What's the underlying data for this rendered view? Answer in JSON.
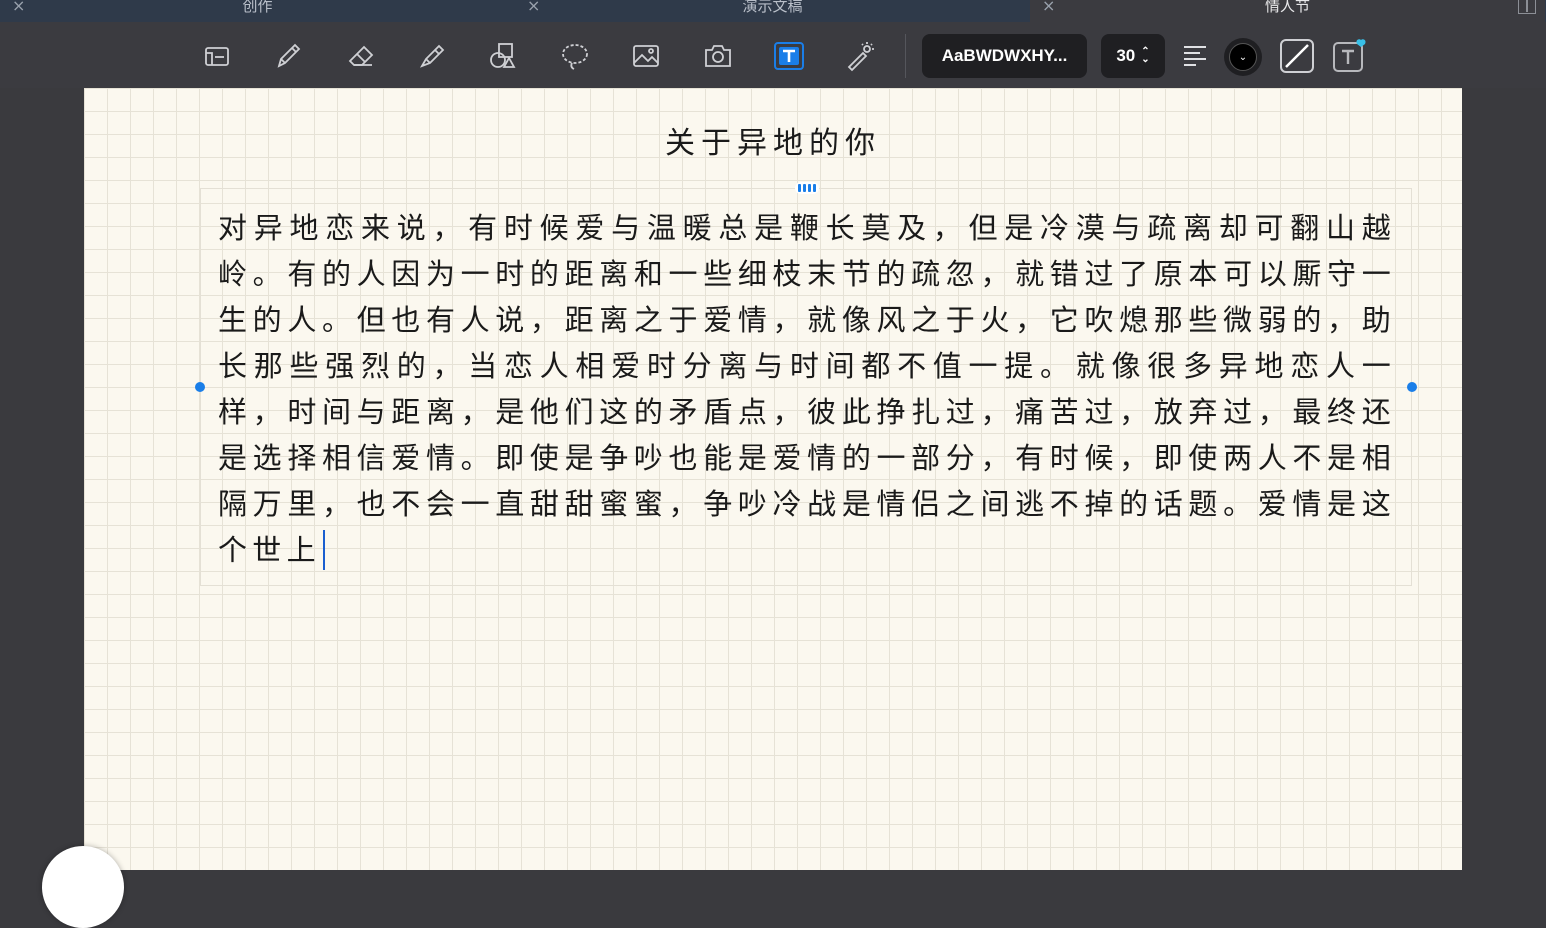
{
  "tabs": [
    {
      "label": "创作",
      "close": "×"
    },
    {
      "label": "演示文稿",
      "close": "×"
    },
    {
      "label": "情人节",
      "close": "×"
    }
  ],
  "toolbar": {
    "font_label": "AaBWDWXHY...",
    "font_size": "30",
    "size_arrows_up": "⌃",
    "size_arrows_down": "⌄",
    "color_value": "#000000",
    "color_chevron": "⌄"
  },
  "document": {
    "title": "关于异地的你",
    "body": "对异地恋来说，有时候爱与温暖总是鞭长莫及，但是冷漠与疏离却可翻山越岭。有的人因为一时的距离和一些细枝末节的疏忽，就错过了原本可以厮守一生的人。但也有人说，距离之于爱情，就像风之于火，它吹熄那些微弱的，助长那些强烈的，当恋人相爱时分离与时间都不值一提。就像很多异地恋人一样，时间与距离，是他们这的矛盾点，彼此挣扎过，痛苦过，放弃过，最终还是选择相信爱情。即使是争吵也能是爱情的一部分，有时候，即使两人不是相隔万里，也不会一直甜甜蜜蜜，争吵冷战是情侣之间逃不掉的话题。爱情是这个世上"
  },
  "colors": {
    "accent": "#1a7ee8",
    "paper": "#fbf8ef",
    "toolbar_bg": "#3b3b40",
    "tabbar_bg": "#2f3a4a"
  }
}
